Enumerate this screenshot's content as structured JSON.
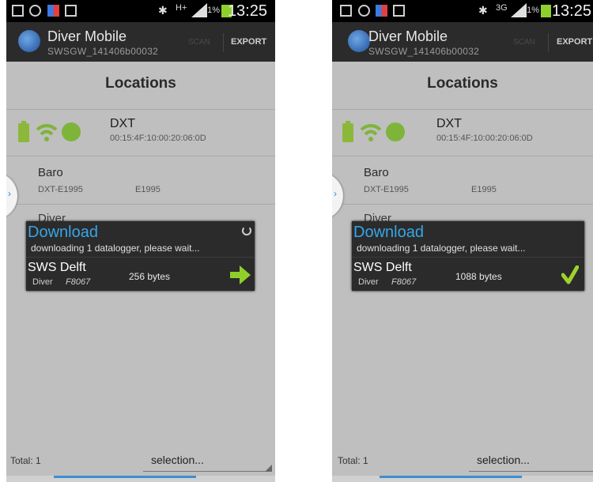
{
  "panels": [
    {
      "status_time": "13:25",
      "status_network": "H+",
      "status_battery": "81%",
      "app_title": "Diver Mobile",
      "app_subtitle": "SWSGW_141406b00032",
      "scan_label": "SCAN",
      "export_label": "EXPORT",
      "header": "Locations",
      "dxt_name": "DXT",
      "dxt_mac": "00:15:4F:10:00:20:06:0D",
      "baro_name": "Baro",
      "baro_id": "DXT-E1995",
      "baro_code": "E1995",
      "diver_peek": "Diver",
      "dialog_title": "Download",
      "dialog_message": "downloading 1 datalogger, please wait...",
      "device_name": "SWS Delft",
      "device_type": "Diver",
      "device_serial": "F8067",
      "bytes": "256 bytes",
      "status_icon": "arrow-right-icon",
      "total": "Total: 1",
      "selection": "selection..."
    },
    {
      "status_time": "13:25",
      "status_network": "3G",
      "status_battery": "81%",
      "app_title": "Diver Mobile",
      "app_subtitle": "SWSGW_141406b00032",
      "scan_label": "SCAN",
      "export_label": "EXPORT",
      "header": "Locations",
      "dxt_name": "DXT",
      "dxt_mac": "00:15:4F:10:00:20:06:0D",
      "baro_name": "Baro",
      "baro_id": "DXT-E1995",
      "baro_code": "E1995",
      "diver_peek": "Diver",
      "dialog_title": "Download",
      "dialog_message": "downloading 1 datalogger, please wait...",
      "device_name": "SWS Delft",
      "device_type": "Diver",
      "device_serial": "F8067",
      "bytes": "1088 bytes",
      "status_icon": "checkmark-icon",
      "total": "Total: 1",
      "selection": "selection..."
    }
  ],
  "colors": {
    "accent": "#36a6e6",
    "status_green": "#8fd12c",
    "device_green": "#7fb43a"
  }
}
